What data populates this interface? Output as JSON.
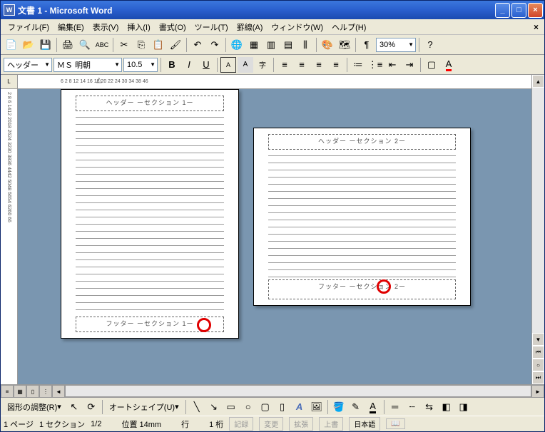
{
  "title": "文書 1 - Microsoft Word",
  "menu": {
    "file": "ファイル(F)",
    "edit": "編集(E)",
    "view": "表示(V)",
    "insert": "挿入(I)",
    "format": "書式(O)",
    "tools": "ツール(T)",
    "table": "罫線(A)",
    "window": "ウィンドウ(W)",
    "help": "ヘルプ(H)",
    "close_x": "×"
  },
  "tb1": {
    "zoom": "30%"
  },
  "tb2": {
    "style": "ヘッダー",
    "font": "ＭＳ 明朝",
    "size": "10.5",
    "b": "B",
    "i": "I",
    "u": "U"
  },
  "ruler": {
    "h": [
      "6",
      "2",
      "8",
      "12",
      "14",
      "16",
      "18",
      "20",
      "22",
      "24",
      "30",
      "34",
      "38",
      "46"
    ],
    "v": [
      "2",
      "8",
      "6",
      "1412",
      "2018",
      "2624",
      "3230",
      "3836",
      "4442",
      "5048",
      "5654",
      "6260",
      "66"
    ]
  },
  "page1": {
    "header": "ヘッダー ーセクション 1ー",
    "footer": "フッター ーセクション 1ー"
  },
  "page2": {
    "header": "ヘッダー ーセクション 2ー",
    "footer": "フッター ーセクション 2ー"
  },
  "drawbar": {
    "adjust": "図形の調整(R)",
    "autoshape": "オートシェイプ(U)"
  },
  "status": {
    "page": "1 ページ",
    "section": "1 セクション",
    "pageof": "1/2",
    "pos": "位置 14mm",
    "line": "行",
    "col": "1 桁",
    "rec": "記録",
    "trk": "変更",
    "ext": "拡張",
    "ovr": "上書",
    "lang": "日本語"
  }
}
